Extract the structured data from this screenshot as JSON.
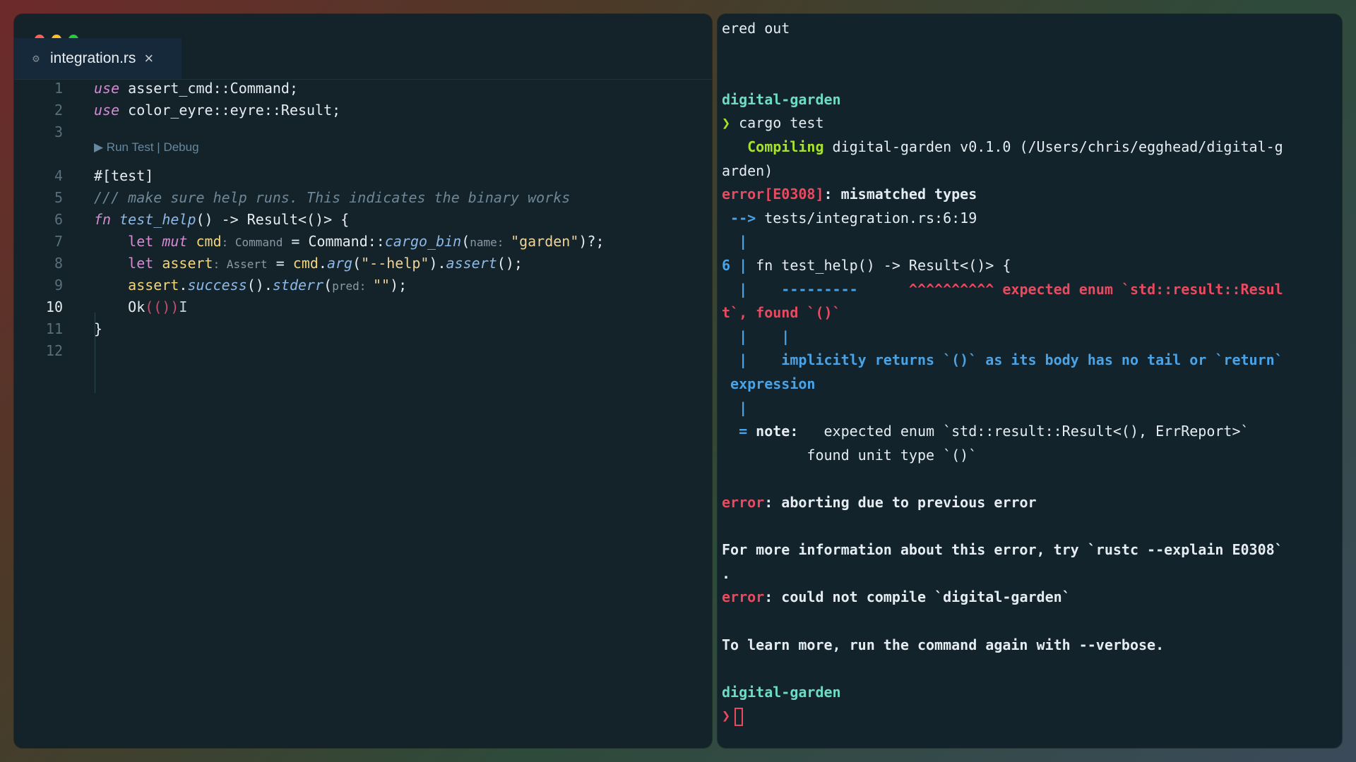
{
  "editor": {
    "tab": {
      "title": "integration.rs",
      "close": "×"
    },
    "codelens": "▶ Run Test | Debug",
    "lines": [
      {
        "n": "1",
        "parts": [
          [
            "kw",
            "use"
          ],
          [
            "pnc",
            " assert_cmd::Command;"
          ]
        ]
      },
      {
        "n": "2",
        "parts": [
          [
            "kw",
            "use"
          ],
          [
            "pnc",
            " color_eyre::eyre::Result;"
          ]
        ]
      },
      {
        "n": "3",
        "parts": []
      },
      {
        "n": "4",
        "parts": [
          [
            "pnc",
            "#[test]"
          ]
        ]
      },
      {
        "n": "5",
        "parts": [
          [
            "cmt",
            "/// make sure help runs. This indicates the binary works"
          ]
        ]
      },
      {
        "n": "6",
        "parts": [
          [
            "kw",
            "fn"
          ],
          [
            "pnc",
            " "
          ],
          [
            "fn",
            "test_help"
          ],
          [
            "pnc",
            "() -> Result<()> {"
          ]
        ]
      },
      {
        "n": "7",
        "parts": [
          [
            "pnc",
            "    "
          ],
          [
            "kw2",
            "let"
          ],
          [
            "pnc",
            " "
          ],
          [
            "kw",
            "mut"
          ],
          [
            "pnc",
            " "
          ],
          [
            "var",
            "cmd"
          ],
          [
            "hint",
            ": Command"
          ],
          [
            "pnc",
            " = Command::"
          ],
          [
            "fn",
            "cargo_bin"
          ],
          [
            "pnc",
            "("
          ],
          [
            "hint",
            "name: "
          ],
          [
            "str",
            "\"garden\""
          ],
          [
            "pnc",
            ")?;"
          ]
        ]
      },
      {
        "n": "8",
        "parts": [
          [
            "pnc",
            "    "
          ],
          [
            "kw2",
            "let"
          ],
          [
            "pnc",
            " "
          ],
          [
            "var",
            "assert"
          ],
          [
            "hint",
            ": Assert"
          ],
          [
            "pnc",
            " = "
          ],
          [
            "var",
            "cmd"
          ],
          [
            "pnc",
            "."
          ],
          [
            "fn",
            "arg"
          ],
          [
            "pnc",
            "("
          ],
          [
            "str",
            "\"--help\""
          ],
          [
            "pnc",
            ")."
          ],
          [
            "fn",
            "assert"
          ],
          [
            "pnc",
            "();"
          ]
        ]
      },
      {
        "n": "9",
        "parts": [
          [
            "pnc",
            "    "
          ],
          [
            "var",
            "assert"
          ],
          [
            "pnc",
            "."
          ],
          [
            "fn",
            "success"
          ],
          [
            "pnc",
            "()."
          ],
          [
            "fn",
            "stderr"
          ],
          [
            "pnc",
            "("
          ],
          [
            "hint",
            "pred: "
          ],
          [
            "str",
            "\"\""
          ],
          [
            "pnc",
            ");"
          ]
        ]
      },
      {
        "n": "10",
        "parts": [
          [
            "pnc",
            "    Ok"
          ],
          [
            "paren1",
            "(())"
          ],
          [
            "cursor-i",
            "I"
          ]
        ]
      },
      {
        "n": "11",
        "parts": [
          [
            "pnc",
            "}"
          ]
        ]
      },
      {
        "n": "12",
        "parts": []
      }
    ]
  },
  "terminal": {
    "lines": [
      [
        [
          "white",
          "ered out"
        ]
      ],
      [],
      [],
      [
        [
          "cyan",
          "digital-garden"
        ]
      ],
      [
        [
          "green",
          "❯"
        ],
        [
          "white",
          " cargo test"
        ]
      ],
      [
        [
          "green",
          "   Compiling"
        ],
        [
          "white",
          " digital-garden v0.1.0 (/Users/chris/egghead/digital-g"
        ]
      ],
      [
        [
          "white",
          "arden)"
        ]
      ],
      [
        [
          "redb",
          "error[E0308]"
        ],
        [
          "bold",
          ": mismatched types"
        ]
      ],
      [
        [
          "blueb",
          " -->"
        ],
        [
          "white",
          " tests/integration.rs:6:19"
        ]
      ],
      [
        [
          "blueb",
          "  |"
        ]
      ],
      [
        [
          "blueb",
          "6 |"
        ],
        [
          "white",
          " fn test_help() -> Result<()> {"
        ]
      ],
      [
        [
          "blueb",
          "  |"
        ],
        [
          "blueb",
          "    ---------"
        ],
        [
          "white",
          "      "
        ],
        [
          "redb",
          "^^^^^^^^^^ expected enum `std::result::Resul"
        ]
      ],
      [
        [
          "redb",
          "t`, found `()`"
        ]
      ],
      [
        [
          "blueb",
          "  |    |"
        ]
      ],
      [
        [
          "blueb",
          "  |    implicitly returns `()` as its body has no tail or `return`"
        ]
      ],
      [
        [
          "blueb",
          " expression"
        ]
      ],
      [
        [
          "blueb",
          "  |"
        ]
      ],
      [
        [
          "blueb",
          "  ="
        ],
        [
          "bold",
          " note:"
        ],
        [
          "white",
          "   expected enum `std::result::Result<(), ErrReport>`"
        ]
      ],
      [
        [
          "white",
          "          found unit type `()`"
        ]
      ],
      [],
      [
        [
          "redb",
          "error"
        ],
        [
          "bold",
          ": aborting due to previous error"
        ]
      ],
      [],
      [
        [
          "bold",
          "For more information about this error, try `rustc --explain E0308`"
        ]
      ],
      [
        [
          "bold",
          "."
        ]
      ],
      [
        [
          "redb",
          "error"
        ],
        [
          "bold",
          ": could not compile `digital-garden`"
        ]
      ],
      [],
      [
        [
          "bold",
          "To learn more, run the command again with --verbose."
        ]
      ],
      [],
      [
        [
          "cyan",
          "digital-garden"
        ]
      ],
      [
        [
          "redb",
          "❯"
        ]
      ]
    ]
  },
  "colors": {
    "editor_bg": "#142229",
    "terminal_bg": "#13232b",
    "error_red": "#e84a5f",
    "prompt_cyan": "#6ddbc6",
    "compile_green": "#a6e22e",
    "gutter_blue": "#4aa3e6"
  }
}
